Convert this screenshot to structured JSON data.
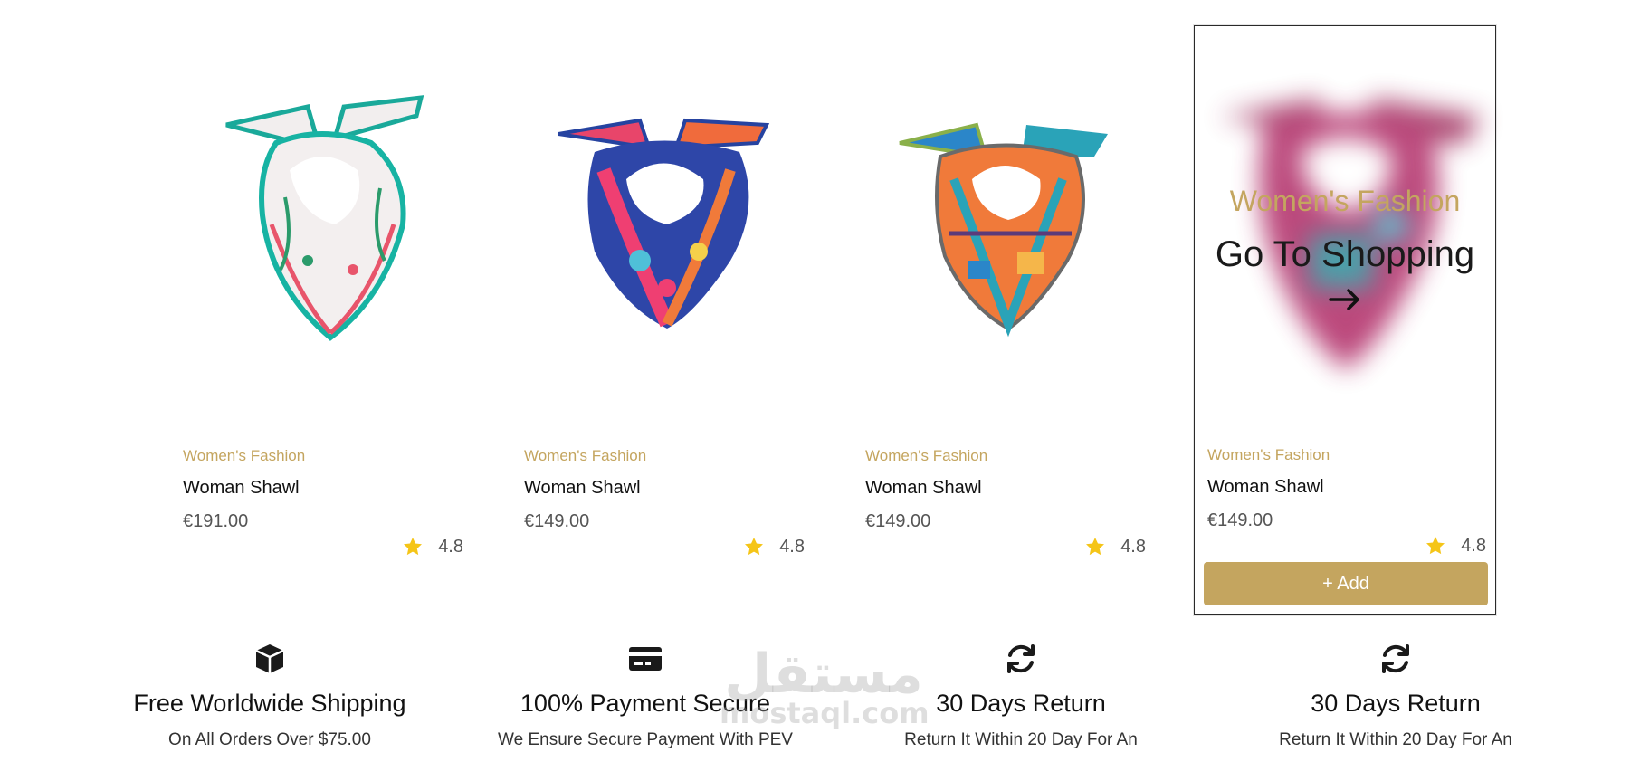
{
  "products": [
    {
      "category": "Women's Fashion",
      "title": "Woman Shawl",
      "price": "€191.00",
      "rating": "4.8",
      "image": "shawl-white-floral"
    },
    {
      "category": "Women's Fashion",
      "title": "Woman Shawl",
      "price": "€149.00",
      "rating": "4.8",
      "image": "shawl-pink-blue"
    },
    {
      "category": "Women's Fashion",
      "title": "Woman Shawl",
      "price": "€149.00",
      "rating": "4.8",
      "image": "shawl-orange-geometric"
    },
    {
      "category": "Women's Fashion",
      "title": "Woman Shawl",
      "price": "€149.00",
      "rating": "4.8",
      "image": "shawl-magenta"
    }
  ],
  "hover_card": {
    "category": "Women's Fashion",
    "cta": "Go To Shopping",
    "cta_icon": "arrow-right-icon",
    "add_label": "+ Add"
  },
  "features": [
    {
      "icon": "box-icon",
      "title": "Free Worldwide Shipping",
      "subtitle": "On All Orders Over $75.00"
    },
    {
      "icon": "credit-card-icon",
      "title": "100% Payment Secure",
      "subtitle": "We Ensure Secure Payment With PEV"
    },
    {
      "icon": "refresh-icon",
      "title": "30 Days Return",
      "subtitle": "Return It Within 20 Day For An"
    },
    {
      "icon": "refresh-icon",
      "title": "30 Days Return",
      "subtitle": "Return It Within 20 Day For An"
    }
  ],
  "watermark": {
    "arabic": "مستقل",
    "latin": "mostaql.com"
  },
  "colors": {
    "accent": "#c4a55f",
    "star": "#f5c518",
    "text": "#111111"
  }
}
